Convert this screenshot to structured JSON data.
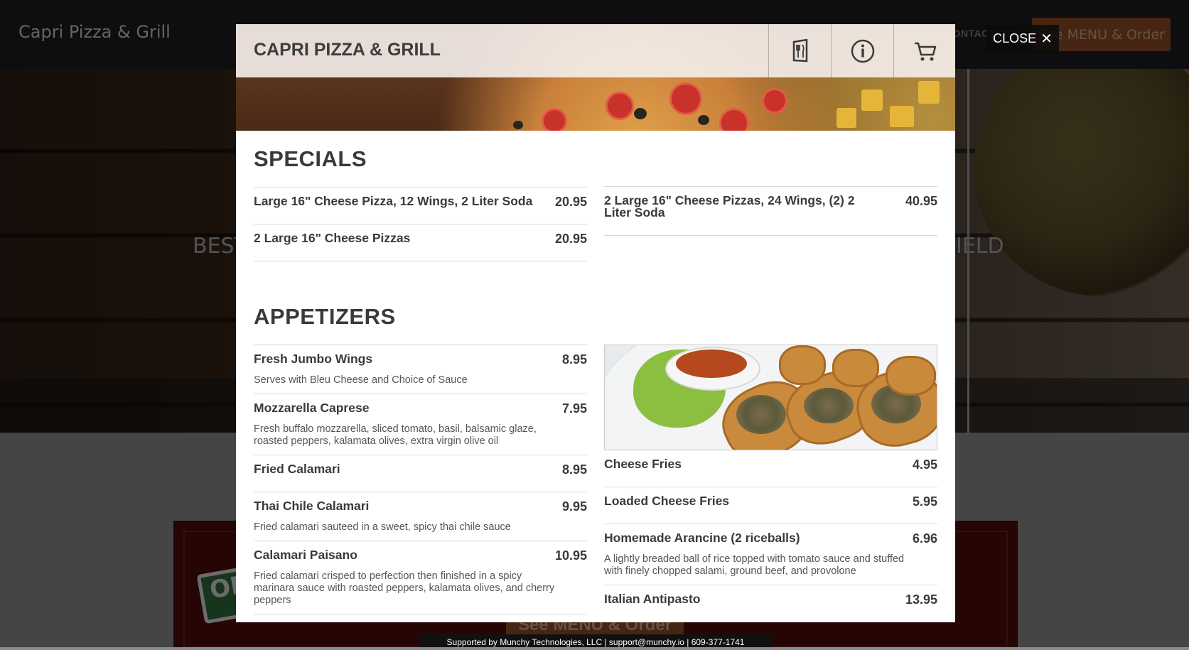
{
  "background": {
    "brand": "Capri Pizza & Grill",
    "nav_contact": "CONTACT US",
    "order_button": "See MENU & Order",
    "hero_left": "BEST",
    "hero_right": "IELD",
    "sign_text": "OP",
    "lower_order_button": "See MENU & Order",
    "support_text": "Supported by Munchy Technologies, LLC | support@munchy.io | 609-377-1741"
  },
  "close": {
    "label": "CLOSE",
    "icon": "close-icon"
  },
  "modal": {
    "title": "CAPRI PIZZA & GRILL",
    "topbar_icons": [
      "menu-utensils-icon",
      "info-icon",
      "cart-icon"
    ]
  },
  "specials": {
    "title": "SPECIALS",
    "left": [
      {
        "name": "Large 16\" Cheese Pizza, 12 Wings, 2 Liter Soda",
        "price": "20.95"
      },
      {
        "name": "2 Large 16\" Cheese Pizzas",
        "price": "20.95"
      }
    ],
    "right": [
      {
        "name": "2 Large 16\" Cheese Pizzas, 24 Wings, (2) 2 Liter Soda",
        "price": "40.95"
      }
    ]
  },
  "appetizers": {
    "title": "APPETIZERS",
    "left": [
      {
        "name": "Fresh Jumbo Wings",
        "price": "8.95",
        "desc": "Serves with Bleu Cheese and Choice of Sauce"
      },
      {
        "name": "Mozzarella Caprese",
        "price": "7.95",
        "desc": "Fresh buffalo mozzarella, sliced tomato, basil, balsamic glaze, roasted peppers, kalamata olives, extra virgin olive oil"
      },
      {
        "name": "Fried Calamari",
        "price": "8.95",
        "desc": ""
      },
      {
        "name": "Thai Chile Calamari",
        "price": "9.95",
        "desc": "Fried calamari sauteed in a sweet, spicy thai chile sauce"
      },
      {
        "name": "Calamari Paisano",
        "price": "10.95",
        "desc": "Fried calamari crisped to perfection then finished in a spicy marinara sauce with roasted peppers, kalamata olives, and cherry peppers"
      }
    ],
    "right": [
      {
        "name": "Cheese Fries",
        "price": "4.95",
        "desc": ""
      },
      {
        "name": "Loaded Cheese Fries",
        "price": "5.95",
        "desc": ""
      },
      {
        "name": "Homemade Arancine (2 riceballs)",
        "price": "6.96",
        "desc": "A lightly breaded ball of rice topped with tomato sauce and stuffed with finely chopped salami, ground beef, and provolone"
      },
      {
        "name": "Italian Antipasto",
        "price": "13.95",
        "desc": ""
      }
    ]
  }
}
